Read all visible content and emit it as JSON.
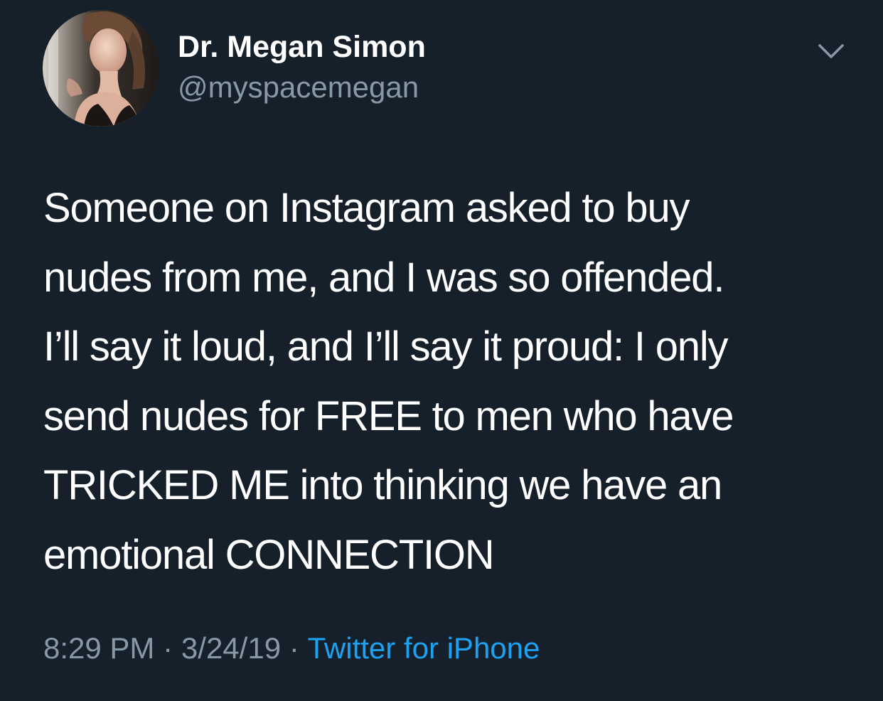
{
  "tweet": {
    "author": {
      "display_name": "Dr. Megan Simon",
      "handle": "@myspacemegan",
      "avatar_icon": "profile-photo"
    },
    "menu_icon": "chevron-down-icon",
    "text_lines": [
      "Someone on Instagram asked to buy",
      "nudes from me, and I was so offended.",
      "I’ll say it loud, and I’ll say it proud: I only",
      "send nudes for FREE to men who have",
      "TRICKED ME into thinking we have an",
      "emotional CONNECTION"
    ],
    "meta": {
      "time": "8:29 PM",
      "separator": "·",
      "date": "3/24/19",
      "source": "Twitter for iPhone"
    }
  },
  "colors": {
    "background": "#15202b",
    "primary_text": "#ffffff",
    "secondary_text": "#8899a6",
    "link": "#1da1f2"
  }
}
